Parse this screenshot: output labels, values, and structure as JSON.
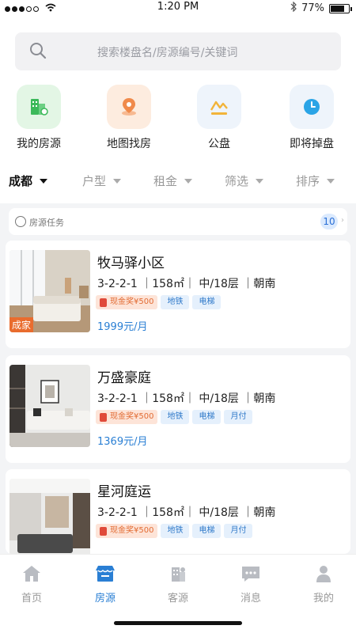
{
  "status_bar": {
    "time": "1:20 PM",
    "battery": "77%"
  },
  "search": {
    "placeholder": "搜索楼盘名/房源编号/关键词"
  },
  "quick_actions": [
    {
      "label": "我的房源",
      "icon": "my-listings-icon"
    },
    {
      "label": "地图找房",
      "icon": "map-pin-icon"
    },
    {
      "label": "公盘",
      "icon": "shared-pool-icon"
    },
    {
      "label": "即将掉盘",
      "icon": "clock-icon"
    }
  ],
  "filters": [
    {
      "label": "成都",
      "active": true
    },
    {
      "label": "户型",
      "active": false
    },
    {
      "label": "租金",
      "active": false
    },
    {
      "label": "筛选",
      "active": false
    },
    {
      "label": "排序",
      "active": false
    }
  ],
  "task_bar": {
    "label": "房源任务",
    "count": "10"
  },
  "listings": [
    {
      "name": "牧马驿小区",
      "meta": "3-2-2-1 ｜158㎡｜ 中/18层 ｜朝南",
      "cash_tag": "现金奖¥500",
      "tags": [
        "地铁",
        "电梯"
      ],
      "price": "1999元/月",
      "brand": "成家"
    },
    {
      "name": "万盛豪庭",
      "meta": "3-2-2-1 ｜158㎡｜ 中/18层 ｜朝南",
      "cash_tag": "现金奖¥500",
      "tags": [
        "地铁",
        "电梯",
        "月付"
      ],
      "price": "1369元/月"
    },
    {
      "name": "星河庭运",
      "meta": "3-2-2-1 ｜158㎡｜ 中/18层 ｜朝南",
      "cash_tag": "现金奖¥500",
      "tags": [
        "地铁",
        "电梯",
        "月付"
      ],
      "price": ""
    }
  ],
  "tabs": [
    {
      "label": "首页",
      "icon": "home-icon",
      "active": false
    },
    {
      "label": "房源",
      "icon": "listings-icon",
      "active": true
    },
    {
      "label": "客源",
      "icon": "clients-icon",
      "active": false
    },
    {
      "label": "消息",
      "icon": "message-icon",
      "active": false
    },
    {
      "label": "我的",
      "icon": "profile-icon",
      "active": false
    }
  ],
  "colors": {
    "accent": "#2a7fd4",
    "cash": "#e26b33",
    "brand_badge": "#e96c2e"
  }
}
